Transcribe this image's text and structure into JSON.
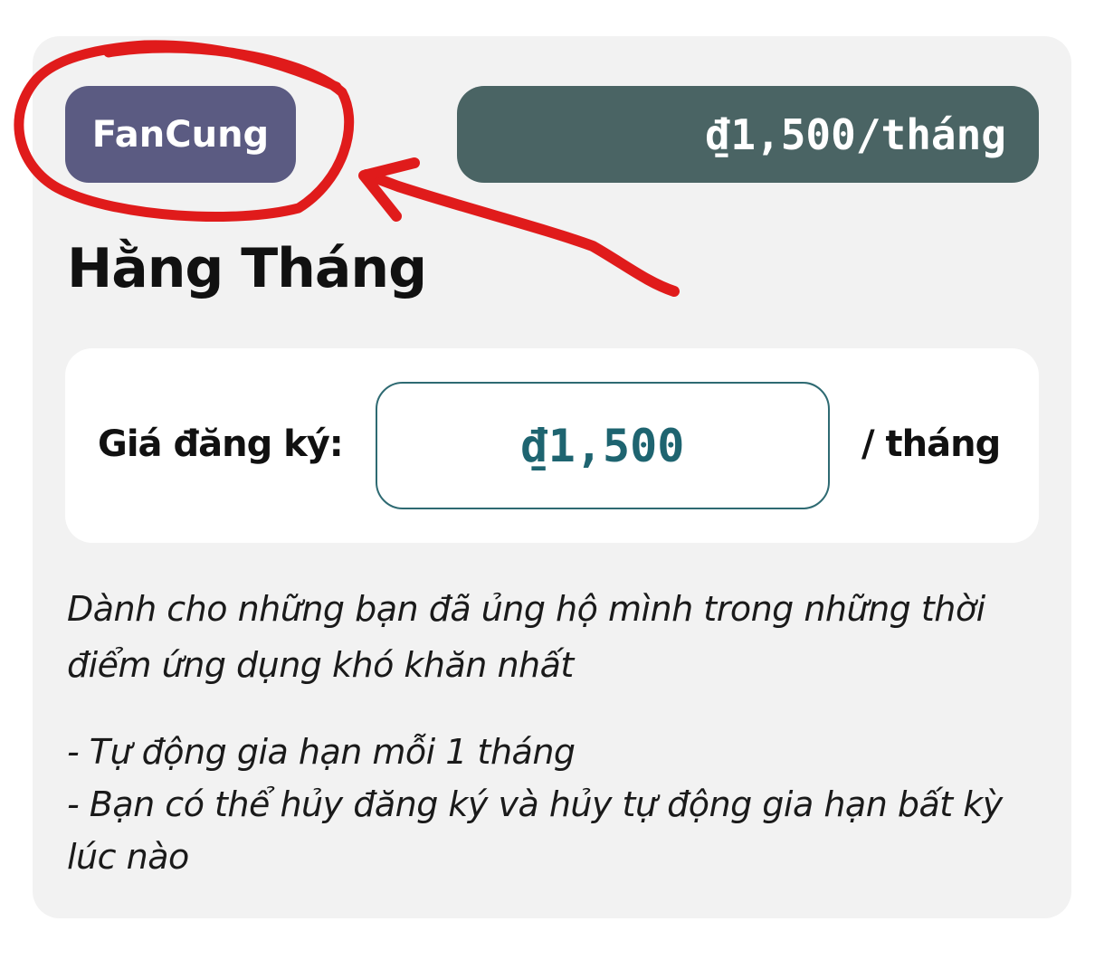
{
  "plan": {
    "tier_name": "FanCung",
    "price_summary": "₫1,500/tháng",
    "title": "Hằng Tháng",
    "price_label": "Giá đăng ký:",
    "price_value": "₫1,500",
    "price_unit": "/ tháng",
    "description": "Dành cho những bạn đã ủng hộ mình trong những thời điểm ứng dụng khó khăn nhất",
    "benefits": [
      "- Tự động gia hạn mỗi 1 tháng",
      "- Bạn có thể hủy đăng ký và hủy tự động gia hạn bất kỳ lúc nào"
    ]
  },
  "annotation": {
    "color": "#e01b1b",
    "shapes": [
      "circle-around-tier-badge",
      "arrow-pointing-to-tier-badge"
    ]
  }
}
